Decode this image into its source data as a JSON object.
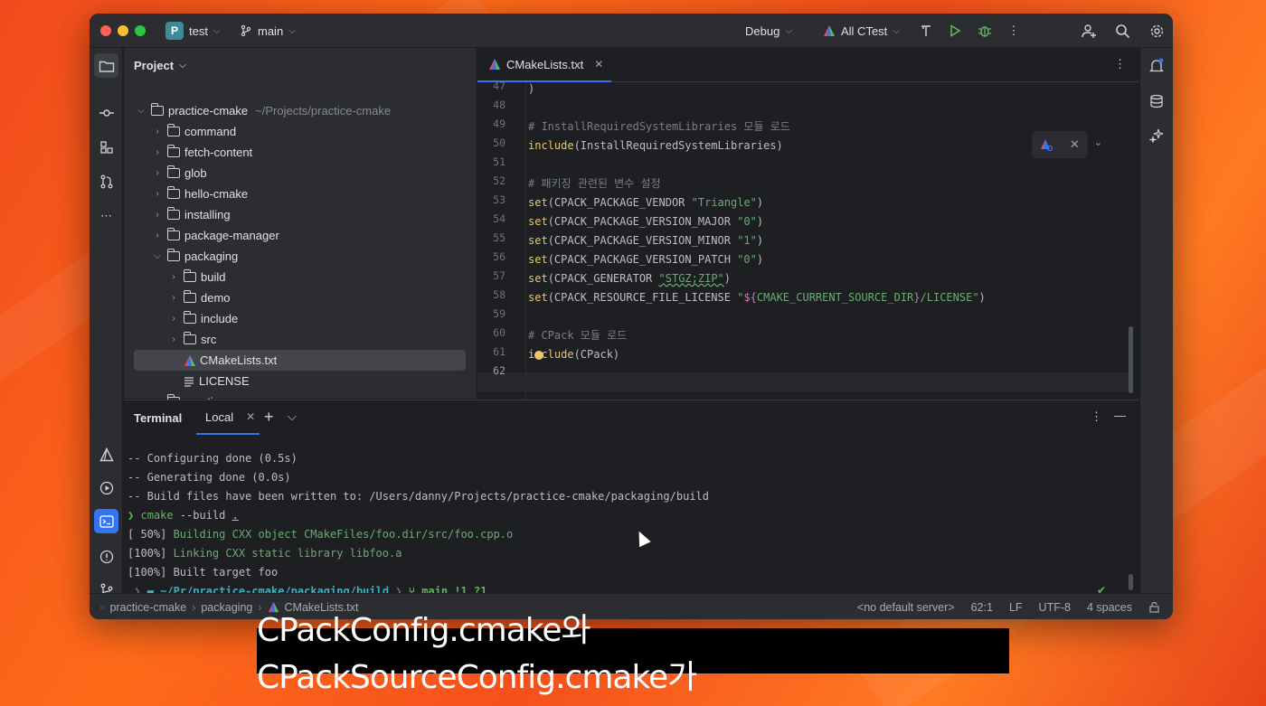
{
  "titlebar": {
    "project_badge": "P",
    "project_name": "test",
    "branch": "main",
    "run_config": "Debug",
    "target": "All CTest"
  },
  "project_panel": {
    "title": "Project",
    "tree": [
      {
        "label": "practice-cmake",
        "path": "~/Projects/practice-cmake",
        "level": 0,
        "expanded": true,
        "type": "folder"
      },
      {
        "label": "command",
        "level": 1,
        "expanded": false,
        "type": "folder"
      },
      {
        "label": "fetch-content",
        "level": 1,
        "expanded": false,
        "type": "folder"
      },
      {
        "label": "glob",
        "level": 1,
        "expanded": false,
        "type": "folder"
      },
      {
        "label": "hello-cmake",
        "level": 1,
        "expanded": false,
        "type": "folder"
      },
      {
        "label": "installing",
        "level": 1,
        "expanded": false,
        "type": "folder"
      },
      {
        "label": "package-manager",
        "level": 1,
        "expanded": false,
        "type": "folder"
      },
      {
        "label": "packaging",
        "level": 1,
        "expanded": true,
        "type": "folder"
      },
      {
        "label": "build",
        "level": 2,
        "expanded": false,
        "type": "folder"
      },
      {
        "label": "demo",
        "level": 2,
        "expanded": false,
        "type": "folder"
      },
      {
        "label": "include",
        "level": 2,
        "expanded": false,
        "type": "folder"
      },
      {
        "label": "src",
        "level": 2,
        "expanded": false,
        "type": "folder"
      },
      {
        "label": "CMakeLists.txt",
        "level": 2,
        "type": "cmake",
        "selected": true
      },
      {
        "label": "LICENSE",
        "level": 2,
        "type": "text"
      },
      {
        "label": "practice",
        "level": 1,
        "expanded": false,
        "type": "folder"
      }
    ]
  },
  "editor": {
    "tab_label": "CMakeLists.txt",
    "inspection_count": "12",
    "lines": [
      {
        "n": "47",
        "text": ")"
      },
      {
        "n": "48",
        "text": ""
      },
      {
        "n": "49",
        "text": "# InstallRequiredSystemLibraries 모듈 로드"
      },
      {
        "n": "50",
        "text": "include(InstallRequiredSystemLibraries)"
      },
      {
        "n": "51",
        "text": ""
      },
      {
        "n": "52",
        "text": "# 패키징 관련된 변수 설정"
      },
      {
        "n": "53",
        "text": "set(CPACK_PACKAGE_VENDOR \"Triangle\")"
      },
      {
        "n": "54",
        "text": "set(CPACK_PACKAGE_VERSION_MAJOR \"0\")"
      },
      {
        "n": "55",
        "text": "set(CPACK_PACKAGE_VERSION_MINOR \"1\")"
      },
      {
        "n": "56",
        "text": "set(CPACK_PACKAGE_VERSION_PATCH \"0\")"
      },
      {
        "n": "57",
        "text": "set(CPACK_GENERATOR \"STGZ;ZIP\")"
      },
      {
        "n": "58",
        "text": "set(CPACK_RESOURCE_FILE_LICENSE \"${CMAKE_CURRENT_SOURCE_DIR}/LICENSE\")"
      },
      {
        "n": "59",
        "text": ""
      },
      {
        "n": "60",
        "text": "# CPack 모듈 로드"
      },
      {
        "n": "61",
        "text": "include(CPack)"
      },
      {
        "n": "62",
        "text": ""
      }
    ]
  },
  "terminal": {
    "title": "Terminal",
    "tab_label": "Local",
    "lines": [
      "-- Configuring done (0.5s)",
      "-- Generating done (0.0s)",
      "-- Build files have been written to: /Users/danny/Projects/practice-cmake/packaging/build"
    ],
    "prompt_symbol": "❯",
    "command": "cmake",
    "command_args": " --build ",
    "command_dot": ".",
    "build_lines": [
      {
        "prefix": "[ 50%] ",
        "text": "Building CXX object CMakeFiles/foo.dir/src/foo.cpp.o"
      },
      {
        "prefix": "[100%] ",
        "text": "Linking CXX static library libfoo.a"
      },
      {
        "prefix": "[100%] ",
        "text": "Built target foo"
      }
    ],
    "ps_path_prefix": "~/Pr/",
    "ps_path_bold1": "practice-cmake",
    "ps_path_mid": "/packaging/",
    "ps_path_bold2": "build",
    "ps_branch": "main !1 ?1"
  },
  "statusbar": {
    "crumbs": [
      "practice-cmake",
      "packaging",
      "CMakeLists.txt"
    ],
    "server": "<no default server>",
    "position": "62:1",
    "line_sep": "LF",
    "encoding": "UTF-8",
    "indent": "4 spaces"
  },
  "subtitle": "CPackConfig.cmake와 CPackSourceConfig.cmake가",
  "colors": {
    "accent": "#3574f0",
    "background": "#1e1f22",
    "panel": "#2b2d30",
    "keyword": "#e6c86e",
    "string": "#6aab73"
  }
}
